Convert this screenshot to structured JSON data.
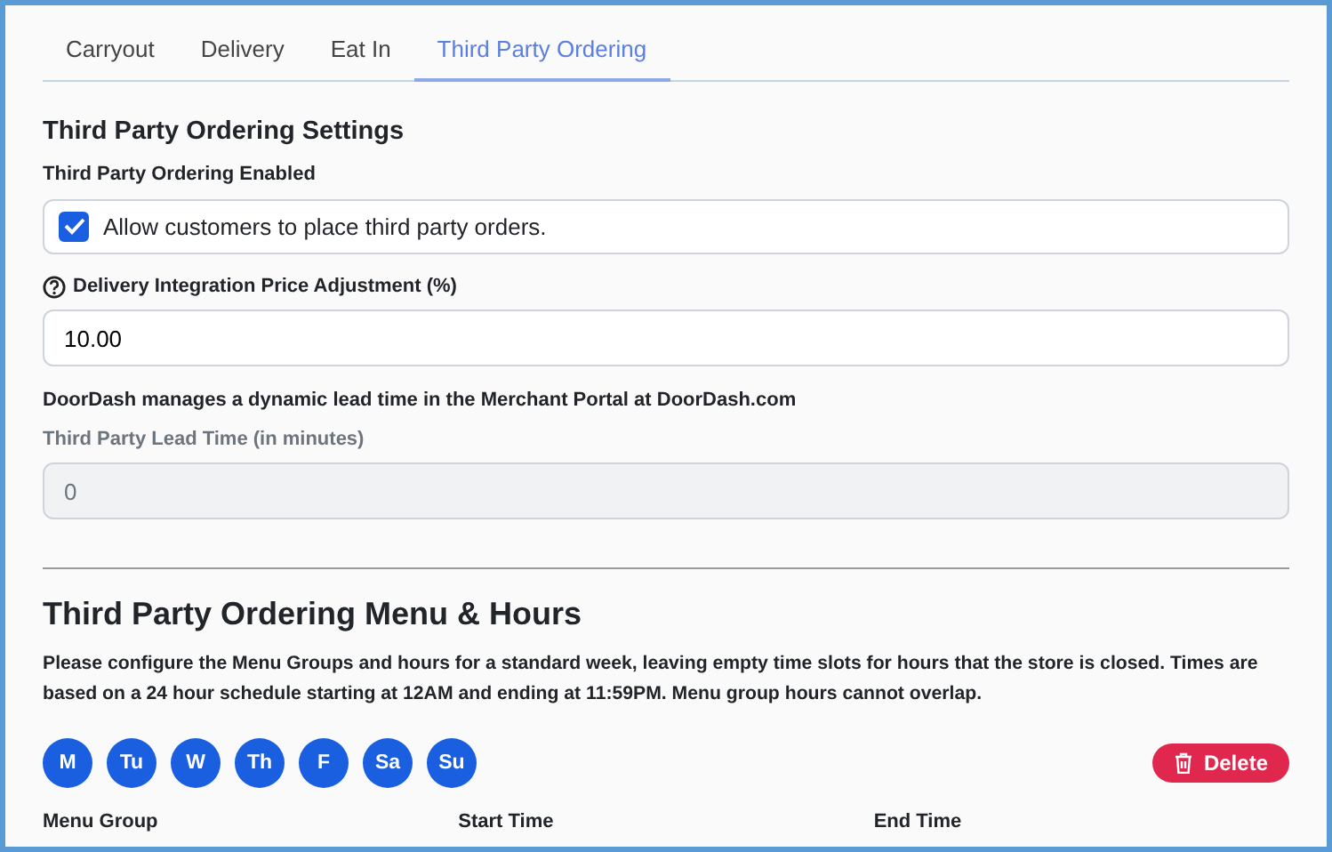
{
  "tabs": [
    {
      "label": "Carryout",
      "selected": false
    },
    {
      "label": "Delivery",
      "selected": false
    },
    {
      "label": "Eat In",
      "selected": false
    },
    {
      "label": "Third Party Ordering",
      "selected": true
    }
  ],
  "settings": {
    "title": "Third Party Ordering Settings",
    "enabled_label": "Third Party Ordering Enabled",
    "allow": {
      "label": "Allow customers to place third party orders.",
      "checked": true
    },
    "price_label": "Delivery Integration Price Adjustment (%)",
    "price_value": "10.00",
    "note": "DoorDash manages a dynamic lead time in the Merchant Portal at DoorDash.com",
    "lead_label": "Third Party Lead Time (in minutes)",
    "lead_value": "0",
    "lead_disabled": true
  },
  "menu_hours": {
    "title": "Third Party Ordering Menu & Hours",
    "description": "Please configure the Menu Groups and hours for a standard week, leaving empty time slots for hours that the store is closed. Times are based on a 24 hour schedule starting at 12AM and ending at 11:59PM. Menu group hours cannot overlap.",
    "days": [
      {
        "label": "M",
        "selected": true
      },
      {
        "label": "Tu",
        "selected": true
      },
      {
        "label": "W",
        "selected": true
      },
      {
        "label": "Th",
        "selected": true
      },
      {
        "label": "F",
        "selected": true
      },
      {
        "label": "Sa",
        "selected": true
      },
      {
        "label": "Su",
        "selected": true
      }
    ],
    "delete_button": "Delete",
    "columns": [
      "Menu Group",
      "Start Time",
      "End Time"
    ]
  }
}
